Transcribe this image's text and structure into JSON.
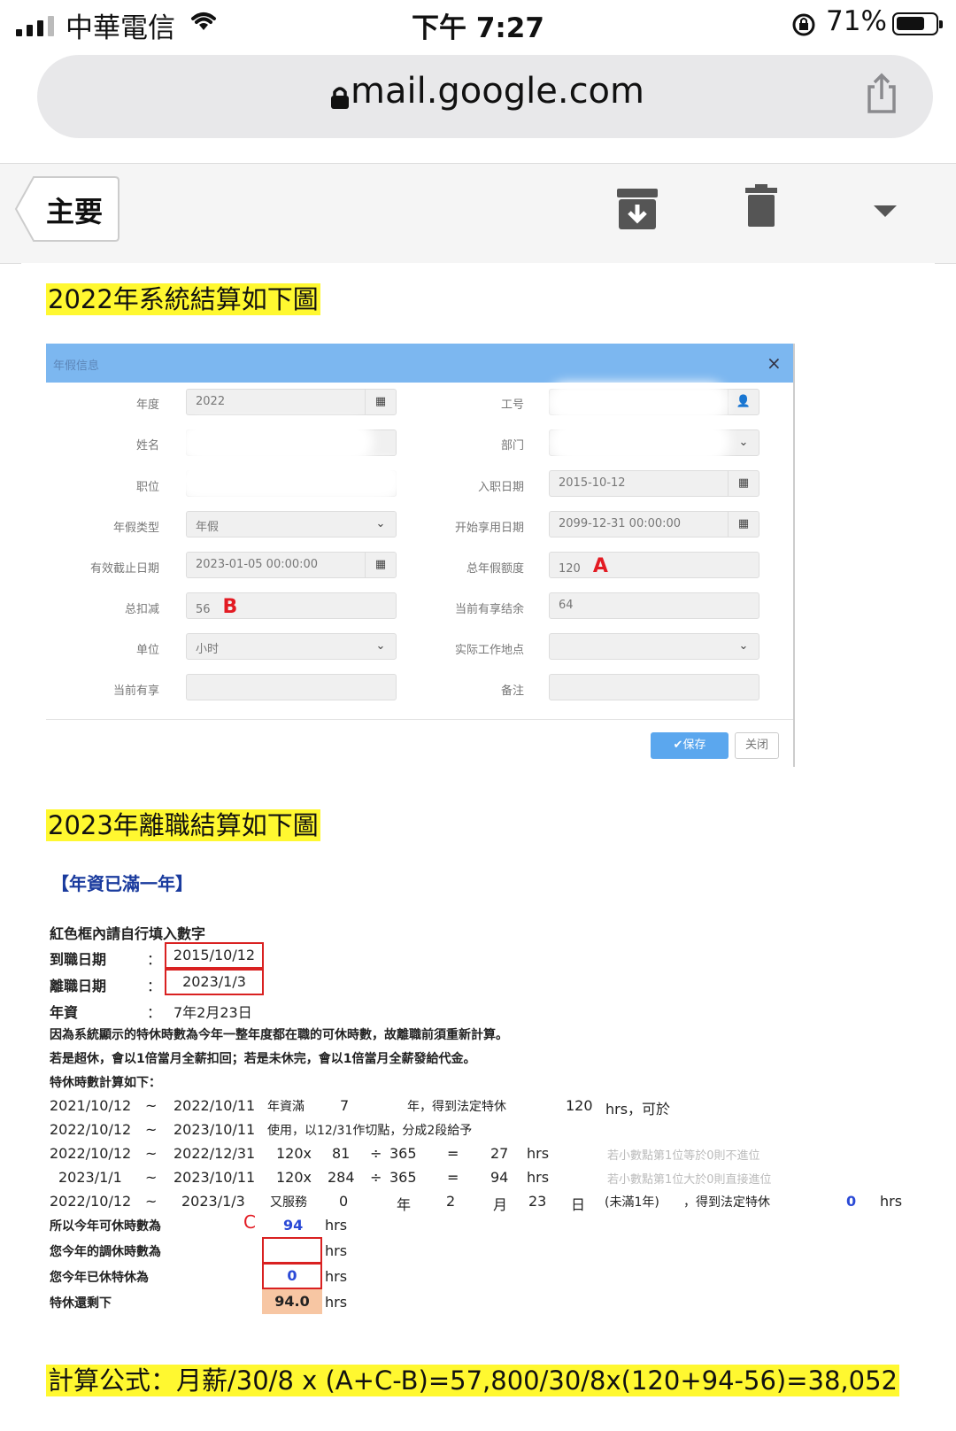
{
  "status_bar": {
    "carrier": "中華電信",
    "time": "下午 7:27",
    "battery_pct": "71%",
    "battery_level": 0.71
  },
  "browser": {
    "url": "mail.google.com"
  },
  "gmail_toolbar": {
    "back_label": "主要"
  },
  "email": {
    "heading_2022": "2022年系統結算如下圖",
    "dialog": {
      "title": "年假信息",
      "close": "×",
      "rows": [
        {
          "left_label": "年度",
          "left_value": "2022",
          "right_label": "工号",
          "right_value": ""
        },
        {
          "left_label": "姓名",
          "left_value": "",
          "right_label": "部门",
          "right_value": ""
        },
        {
          "left_label": "职位",
          "left_value": "",
          "right_label": "入职日期",
          "right_value": "2015-10-12"
        },
        {
          "left_label": "年假类型",
          "left_value": "年假",
          "right_label": "开始享用日期",
          "right_value": "2099-12-31 00:00:00"
        },
        {
          "left_label": "有效截止日期",
          "left_value": "2023-01-05 00:00:00",
          "right_label": "总年假额度",
          "right_value": "120"
        },
        {
          "left_label": "总扣减",
          "left_value": "56",
          "right_label": "当前有享结余",
          "right_value": "64"
        },
        {
          "left_label": "单位",
          "left_value": "小时",
          "right_label": "实际工作地点",
          "right_value": ""
        },
        {
          "left_label": "当前有享",
          "left_value": "",
          "right_label": "备注",
          "right_value": ""
        }
      ],
      "mark_a": "A",
      "mark_b": "B",
      "save_label": "✔保存",
      "close_label": "关闭"
    },
    "heading_2023": "2023年離職結算如下圖",
    "calc": {
      "title": "【年資已滿一年】",
      "instruction": "紅色框內請自行填入數字",
      "hire_label": "到職日期",
      "hire_date": "2015/10/12",
      "leave_label": "離職日期",
      "leave_date": "2023/1/3",
      "tenure_label": "年資",
      "tenure": "7年2月23日",
      "note1": "因為系統顯示的特休時數為今年一整年度都在職的可休時數，故離職前須重新計算。",
      "note2": "若是超休，會以1倍當月全薪扣回；若是未休完，會以1倍當月全薪發給代金。",
      "note3": "特休時數計算如下：",
      "colon": "：",
      "tilde": "~",
      "row1": {
        "from": "2021/10/12",
        "to": "2022/10/11",
        "c1": "年資滿",
        "c2": "7",
        "c3": "年，得到法定特休",
        "c4": "120",
        "c5": "hrs，可於"
      },
      "row2": {
        "from": "2022/10/12",
        "to": "2023/10/11",
        "c1": "使用，以12/31作切點，分成2段給予"
      },
      "row3": {
        "from": "2022/10/12",
        "to": "2022/12/31",
        "a": "120x",
        "b": "81",
        "op": "÷",
        "c": "365",
        "eq": "=",
        "r": "27",
        "u": "hrs",
        "note": "若小數點第1位等於0則不進位"
      },
      "row4": {
        "from": "2023/1/1",
        "to": "2023/10/11",
        "a": "120x",
        "b": "284",
        "op": "÷",
        "c": "365",
        "eq": "=",
        "r": "94",
        "u": "hrs",
        "note": "若小數點第1位大於0則直接進位"
      },
      "row5": {
        "from": "2022/10/12",
        "to": "2023/1/3",
        "c1": "又服務",
        "y": "0",
        "yl": "年",
        "m": "2",
        "ml": "月",
        "d": "23",
        "dl": "日",
        "c2": "(未滿1年)",
        "c3": "，得到法定特休",
        "v": "0",
        "u": "hrs"
      },
      "total_label": "所以今年可休時數為",
      "mark_c": "C",
      "total_value": "94",
      "hrs": "hrs",
      "adjust_label": "您今年的調休時數為",
      "adjust_value": "",
      "used_label": "您今年已休特休為",
      "used_value": "0",
      "remain_label": "特休還剩下",
      "remain_value": "94.0"
    },
    "formula": "計算公式：月薪/30/8 x (A+C-B)=57,800/30/8x(120+94-56)=38,052"
  }
}
